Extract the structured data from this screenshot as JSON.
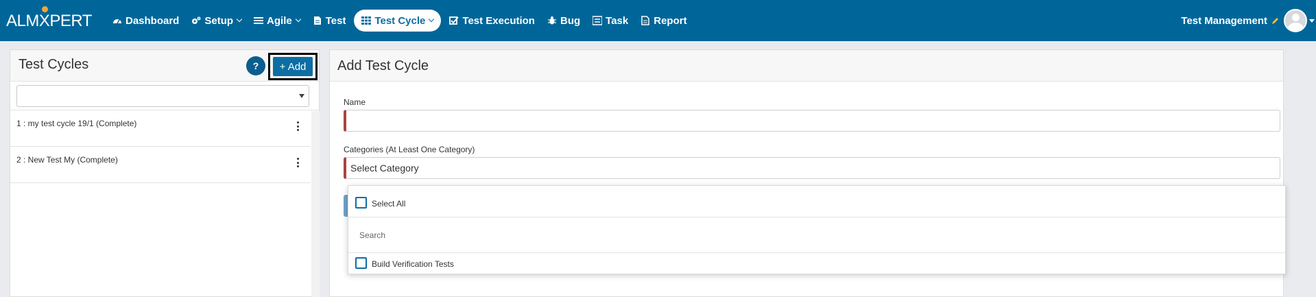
{
  "app": {
    "logo_left": "ALM",
    "logo_x": "X",
    "logo_right": "PERT"
  },
  "nav": {
    "items": [
      {
        "label": "Dashboard",
        "icon": "dashboard-icon",
        "caret": false
      },
      {
        "label": "Setup",
        "icon": "gears-icon",
        "caret": true
      },
      {
        "label": "Agile",
        "icon": "list-icon",
        "caret": true
      },
      {
        "label": "Test",
        "icon": "document-icon",
        "caret": false
      },
      {
        "label": "Test Cycle",
        "icon": "grid-icon",
        "caret": true,
        "active": true
      },
      {
        "label": "Test Execution",
        "icon": "checkbox-icon",
        "caret": false
      },
      {
        "label": "Bug",
        "icon": "bug-icon",
        "caret": false
      },
      {
        "label": "Task",
        "icon": "tasks-icon",
        "caret": false
      },
      {
        "label": "Report",
        "icon": "report-icon",
        "caret": false
      }
    ],
    "user_label": "Test Management"
  },
  "left_panel": {
    "title": "Test Cycles",
    "help_label": "?",
    "add_label": "+ Add",
    "filter_value": "",
    "cycles": [
      {
        "label": "1 : my test cycle 19/1 (Complete)"
      },
      {
        "label": "2 : New Test My (Complete)"
      }
    ]
  },
  "right_panel": {
    "title": "Add Test Cycle",
    "name_label": "Name",
    "name_value": "",
    "categories_label": "Categories (At Least One Category)",
    "categories_value": "Select Category"
  },
  "dropdown": {
    "select_all_label": "Select All",
    "search_placeholder": "Search",
    "options": [
      {
        "label": "Build Verification Tests",
        "checked": false
      }
    ]
  },
  "colors": {
    "navbar": "#006699",
    "accent": "#0d6ea3",
    "required_marker": "#a94442"
  }
}
